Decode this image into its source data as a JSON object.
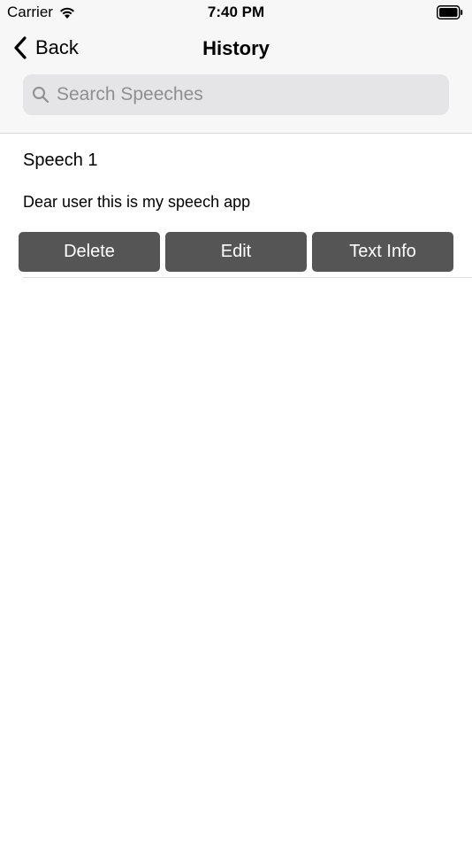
{
  "status_bar": {
    "carrier": "Carrier",
    "time": "7:40 PM",
    "wifi_icon": "wifi-icon",
    "battery_icon": "battery-icon"
  },
  "nav": {
    "back_label": "Back",
    "back_icon": "chevron-left-icon",
    "title": "History"
  },
  "search": {
    "placeholder": "Search Speeches",
    "value": "",
    "icon": "search-icon"
  },
  "speeches": [
    {
      "title": "Speech 1",
      "text": "Dear user this is my speech app",
      "actions": {
        "delete": "Delete",
        "edit": "Edit",
        "info": "Text Info"
      }
    }
  ],
  "colors": {
    "header_bg": "#f7f7f7",
    "search_bg": "#e5e5e7",
    "button_bg": "#555555",
    "button_text": "#ffffff",
    "placeholder": "#8e8e93"
  }
}
